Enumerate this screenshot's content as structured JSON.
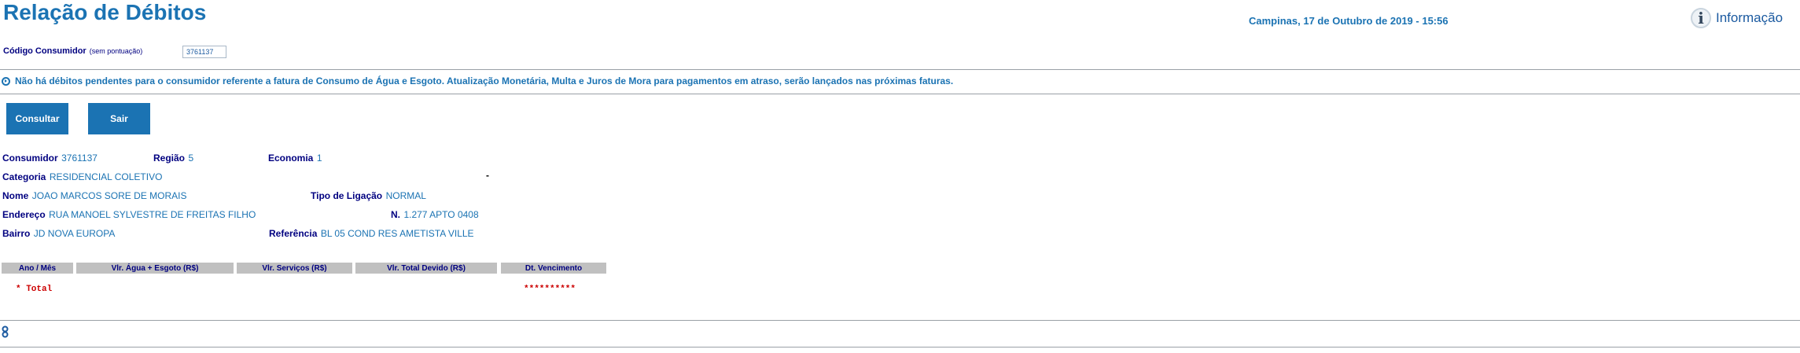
{
  "header": {
    "title": "Relação de Débitos",
    "datetime": "Campinas, 17 de Outubro de 2019 - 15:56",
    "info_label": "Informação"
  },
  "consumer_code": {
    "label": "Código Consumidor",
    "note": "(sem pontuação)",
    "value": "3761137"
  },
  "message": "Não há débitos pendentes para o consumidor referente a fatura de Consumo de Água e Esgoto. Atualização Monetária, Multa e Juros de Mora para pagamentos em atraso, serão lançados nas próximas faturas.",
  "buttons": {
    "consultar": "Consultar",
    "sair": "Sair"
  },
  "details": {
    "consumidor_label": "Consumidor",
    "consumidor_value": "3761137",
    "regiao_label": "Região",
    "regiao_value": "5",
    "economia_label": "Economia",
    "economia_value": "1",
    "categoria_label": "Categoria",
    "categoria_value": "RESIDENCIAL COLETIVO",
    "dash": "-",
    "nome_label": "Nome",
    "nome_value": "JOAO MARCOS SORE DE MORAIS",
    "ligacao_label": "Tipo de Ligação",
    "ligacao_value": "NORMAL",
    "endereco_label": "Endereço",
    "endereco_value": "RUA MANOEL SYLVESTRE DE FREITAS FILHO",
    "numero_label": "N.",
    "numero_value": "1.277 APTO 0408",
    "bairro_label": "Bairro",
    "bairro_value": "JD NOVA EUROPA",
    "referencia_label": "Referência",
    "referencia_value": "BL 05 COND RES AMETISTA VILLE"
  },
  "table": {
    "headers": [
      "Ano / Mês",
      "Vlr. Água + Esgoto (R$)",
      "Vlr. Serviços (R$)",
      "Vlr. Total Devido (R$)",
      "Dt. Vencimento"
    ],
    "total_label": "* Total",
    "total_value": "**********"
  },
  "colors": {
    "accent": "#1b73b3",
    "label": "#000080",
    "total": "#cc0000",
    "header_bg": "#c0c0c0"
  }
}
